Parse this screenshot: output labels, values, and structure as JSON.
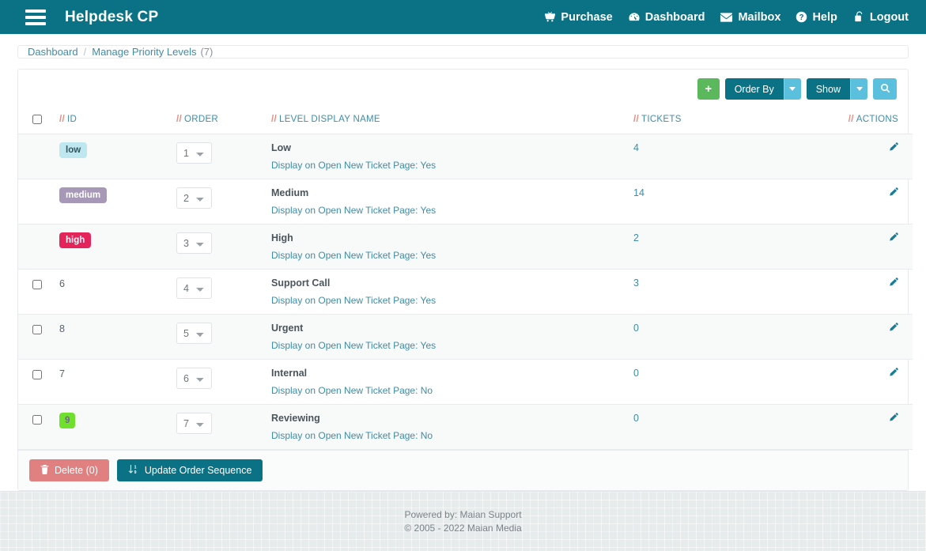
{
  "header": {
    "brand": "Helpdesk CP",
    "menu_icon": "hamburger-icon",
    "nav": [
      {
        "label": "Purchase",
        "icon": "basket-icon"
      },
      {
        "label": "Dashboard",
        "icon": "dashboard-icon"
      },
      {
        "label": "Mailbox",
        "icon": "envelope-icon"
      },
      {
        "label": "Help",
        "icon": "question-circle-icon"
      },
      {
        "label": "Logout",
        "icon": "unlock-icon"
      }
    ]
  },
  "breadcrumb": {
    "root": "Dashboard",
    "separator": "/",
    "current": "Manage Priority Levels",
    "count": "(7)"
  },
  "toolbar": {
    "add_label": "+",
    "order_by_label": "Order By",
    "show_label": "Show",
    "search_icon": "search-icon"
  },
  "table": {
    "headers": {
      "prefix": "//",
      "checkbox": "",
      "id": "ID",
      "order": "ORDER",
      "name": "LEVEL DISPLAY NAME",
      "tickets": "TICKETS",
      "actions": "ACTIONS"
    },
    "order_options": [
      "1",
      "2",
      "3",
      "4",
      "5",
      "6",
      "7"
    ],
    "rows": [
      {
        "has_checkbox": false,
        "id": "low",
        "id_style": "badge-low",
        "order": "1",
        "name": "Low",
        "sub": "Display on Open New Ticket Page: Yes",
        "tickets": "4",
        "action_icon": "pencil-icon"
      },
      {
        "has_checkbox": false,
        "id": "medium",
        "id_style": "badge-medium",
        "order": "2",
        "name": "Medium",
        "sub": "Display on Open New Ticket Page: Yes",
        "tickets": "14",
        "action_icon": "pencil-icon"
      },
      {
        "has_checkbox": false,
        "id": "high",
        "id_style": "badge-high",
        "order": "3",
        "name": "High",
        "sub": "Display on Open New Ticket Page: Yes",
        "tickets": "2",
        "action_icon": "pencil-icon"
      },
      {
        "has_checkbox": true,
        "id": "6",
        "id_style": "plain",
        "order": "4",
        "name": "Support Call",
        "sub": "Display on Open New Ticket Page: Yes",
        "tickets": "3",
        "action_icon": "pencil-icon"
      },
      {
        "has_checkbox": true,
        "id": "8",
        "id_style": "plain",
        "order": "5",
        "name": "Urgent",
        "sub": "Display on Open New Ticket Page: Yes",
        "tickets": "0",
        "action_icon": "pencil-icon"
      },
      {
        "has_checkbox": true,
        "id": "7",
        "id_style": "plain",
        "order": "6",
        "name": "Internal",
        "sub": "Display on Open New Ticket Page: No",
        "tickets": "0",
        "action_icon": "pencil-icon"
      },
      {
        "has_checkbox": true,
        "id": "9",
        "id_style": "badge-green",
        "order": "7",
        "name": "Reviewing",
        "sub": "Display on Open New Ticket Page: No",
        "tickets": "0",
        "action_icon": "pencil-icon"
      }
    ]
  },
  "actions": {
    "delete_label": "Delete (0)",
    "delete_icon": "trash-icon",
    "update_label": "Update Order Sequence",
    "update_icon": "sort-numeric-icon"
  },
  "footer": {
    "powered": "Powered by: Maian Support",
    "copyright": "© 2005 - 2022 Maian Media"
  },
  "colors": {
    "brand_teal": "#0b7285",
    "accent_blue": "#3e8ca8",
    "header_slash": "#e88b82",
    "green": "#5cb85c",
    "light_blue": "#5bc0de",
    "delete_red": "#e08080"
  }
}
